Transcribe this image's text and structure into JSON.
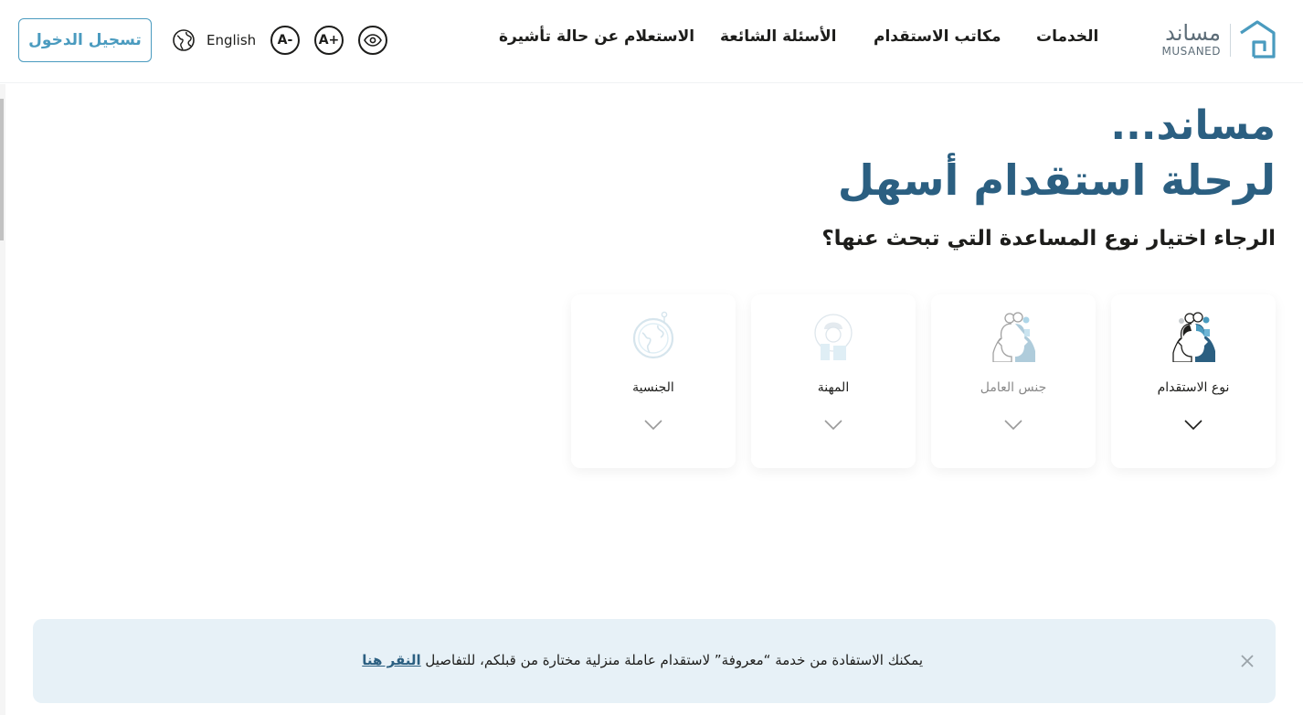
{
  "header": {
    "login_label": "تسجيل الدخول",
    "language_label": "English",
    "font_decrease_label": "A-",
    "font_increase_label": "A+",
    "nav": [
      "الخدمات",
      "مكاتب الاستقدام",
      "الأسئلة الشائعة",
      "الاستعلام عن حالة تأشيرة"
    ],
    "logo": {
      "arabic": "مساند",
      "english": "MUSANED"
    },
    "icons": [
      "globe-icon",
      "eye-icon"
    ]
  },
  "hero": {
    "title_line1": "مساند...",
    "title_line2": "لرحلة استقدام أسهل",
    "question": "الرجاء اختيار نوع المساعدة التي تبحث عنها؟"
  },
  "cards": [
    {
      "label": "نوع الاستقدام",
      "icon": "recruitment-type-icon",
      "state": "active"
    },
    {
      "label": "جنس العامل",
      "icon": "worker-gender-icon",
      "state": "dim"
    },
    {
      "label": "المهنة",
      "icon": "profession-icon",
      "state": "faint"
    },
    {
      "label": "الجنسية",
      "icon": "nationality-globe-icon",
      "state": "faint"
    }
  ],
  "banner": {
    "text": "يمكنك الاستفادة من خدمة “معروفة” لاستقدام عاملة منزلية مختارة من قبلكم، للتفاصيل ",
    "link_label": "النقر هنا"
  },
  "colors": {
    "primary": "#2b5f81",
    "accent": "#4a9bbf",
    "banner_bg": "#e7f1f7",
    "text": "#1d1d1b"
  }
}
